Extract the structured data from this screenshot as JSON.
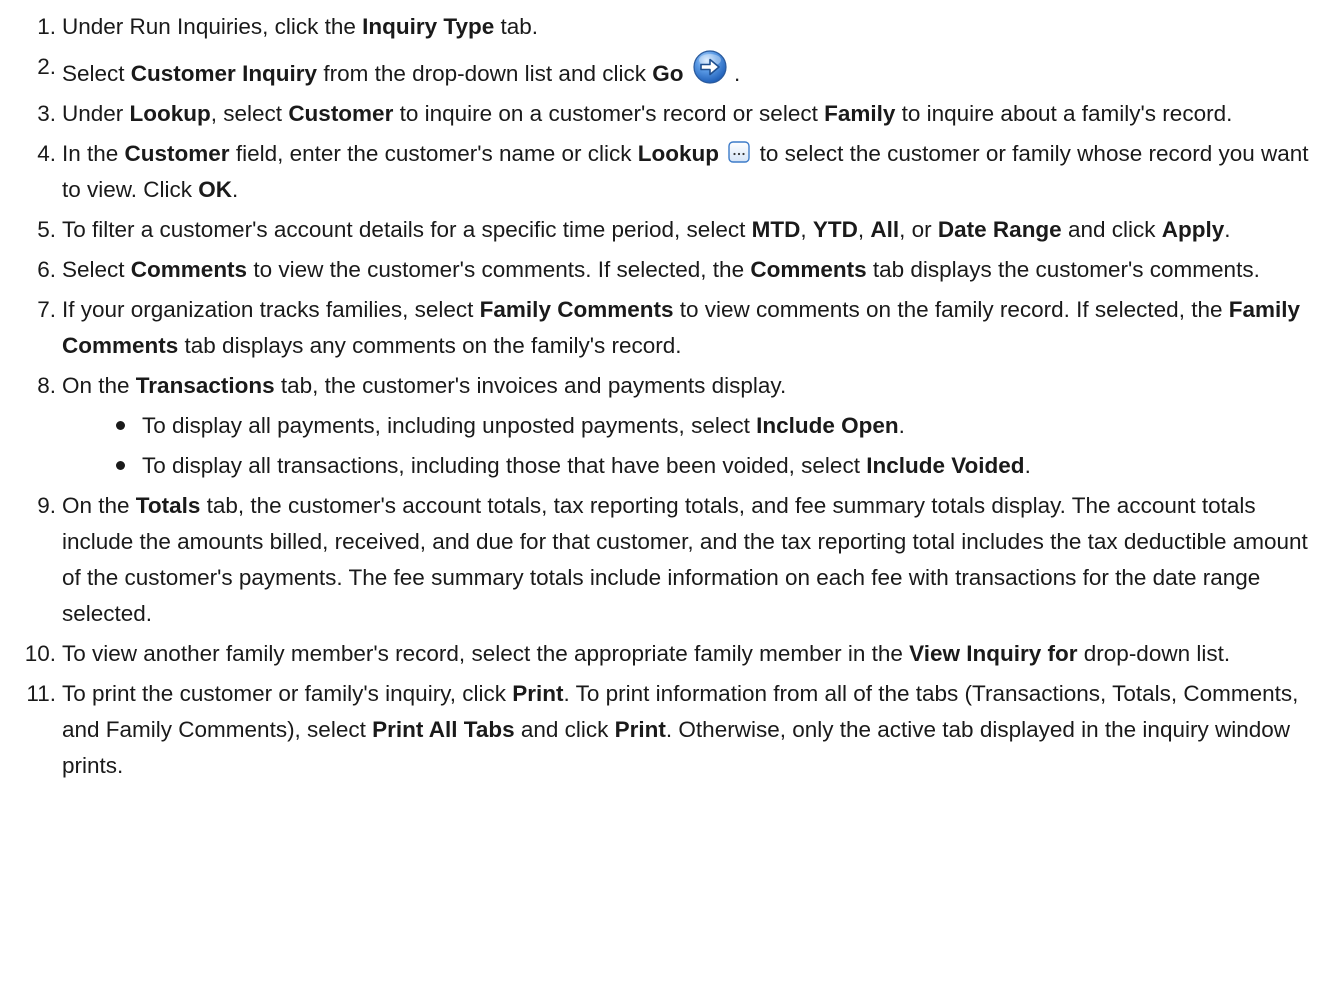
{
  "steps": [
    {
      "num": "1.",
      "parts": [
        {
          "t": "Under Run Inquiries, click the "
        },
        {
          "t": "Inquiry Type",
          "b": true
        },
        {
          "t": " tab."
        }
      ]
    },
    {
      "num": "2.",
      "parts": [
        {
          "t": "Select "
        },
        {
          "t": "Customer Inquiry",
          "b": true
        },
        {
          "t": " from the drop-down list and click "
        },
        {
          "t": "Go",
          "b": true
        },
        {
          "icon": "go-arrow-icon"
        },
        {
          "t": "."
        }
      ]
    },
    {
      "num": "3.",
      "parts": [
        {
          "t": "Under "
        },
        {
          "t": "Lookup",
          "b": true
        },
        {
          "t": ", select "
        },
        {
          "t": "Customer",
          "b": true
        },
        {
          "t": " to inquire on a customer's record or select "
        },
        {
          "t": "Family",
          "b": true
        },
        {
          "t": " to inquire about a family's record."
        }
      ]
    },
    {
      "num": "4.",
      "parts": [
        {
          "t": "In the "
        },
        {
          "t": "Customer",
          "b": true
        },
        {
          "t": " field, enter the customer's name or click "
        },
        {
          "t": "Lookup",
          "b": true
        },
        {
          "icon": "lookup-ellipsis-icon"
        },
        {
          "t": "to select the customer or family whose record you want to view. Click "
        },
        {
          "t": "OK",
          "b": true
        },
        {
          "t": "."
        }
      ]
    },
    {
      "num": "5.",
      "parts": [
        {
          "t": "To filter a customer's account details for a specific time period, select "
        },
        {
          "t": "MTD",
          "b": true
        },
        {
          "t": ", "
        },
        {
          "t": "YTD",
          "b": true
        },
        {
          "t": ", "
        },
        {
          "t": "All",
          "b": true
        },
        {
          "t": ", or "
        },
        {
          "t": "Date Range",
          "b": true
        },
        {
          "t": " and click "
        },
        {
          "t": "Apply",
          "b": true
        },
        {
          "t": "."
        }
      ]
    },
    {
      "num": "6.",
      "parts": [
        {
          "t": "Select "
        },
        {
          "t": "Comments",
          "b": true
        },
        {
          "t": " to view the customer's comments. If selected, the "
        },
        {
          "t": "Comments",
          "b": true
        },
        {
          "t": " tab displays the customer's comments."
        }
      ]
    },
    {
      "num": "7.",
      "parts": [
        {
          "t": "If your organization tracks families, select "
        },
        {
          "t": "Family Comments",
          "b": true
        },
        {
          "t": " to view comments on the family record. If selected, the "
        },
        {
          "t": "Family Comments",
          "b": true
        },
        {
          "t": " tab displays any comments on the family's record."
        }
      ]
    },
    {
      "num": "8.",
      "parts": [
        {
          "t": "On the "
        },
        {
          "t": "Transactions",
          "b": true
        },
        {
          "t": " tab, the customer's invoices and payments display."
        }
      ],
      "sub": [
        [
          {
            "t": "To display all payments, including unposted payments, select "
          },
          {
            "t": "Include Open",
            "b": true
          },
          {
            "t": "."
          }
        ],
        [
          {
            "t": "To display all transactions, including those that have been voided, select "
          },
          {
            "t": "Include Voided",
            "b": true
          },
          {
            "t": "."
          }
        ]
      ]
    },
    {
      "num": "9.",
      "parts": [
        {
          "t": "On the "
        },
        {
          "t": "Totals",
          "b": true
        },
        {
          "t": " tab, the customer's account totals, tax reporting totals, and fee summary totals display. The account totals include the amounts billed, received, and due for that customer, and the tax reporting total includes the tax deductible amount of the customer's payments. The fee summary totals include information on each fee with transactions for the date range selected."
        }
      ]
    },
    {
      "num": "10.",
      "parts": [
        {
          "t": "To view another family member's record, select the appropriate family member in the "
        },
        {
          "t": "View Inquiry for",
          "b": true
        },
        {
          "t": " drop-down list."
        }
      ]
    },
    {
      "num": "11.",
      "parts": [
        {
          "t": "To print the customer or family's inquiry, click "
        },
        {
          "t": "Print",
          "b": true
        },
        {
          "t": ". To print information from all of the tabs (Transactions, Totals, Comments, and Family Comments), select "
        },
        {
          "t": "Print All Tabs",
          "b": true
        },
        {
          "t": " and click "
        },
        {
          "t": "Print",
          "b": true
        },
        {
          "t": ". Otherwise, only the active tab displayed in the inquiry window prints."
        }
      ]
    }
  ]
}
